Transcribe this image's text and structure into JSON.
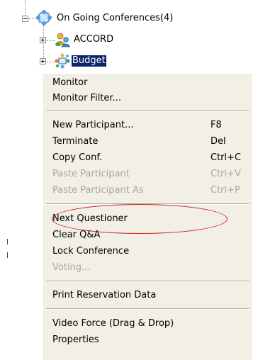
{
  "tree": {
    "root": {
      "label": "On Going Conferences(4)",
      "expander": "minus",
      "icon": "conferences-icon"
    },
    "children": [
      {
        "label": "ACCORD",
        "expander": "plus",
        "icon": "participants-icon",
        "selected": false
      },
      {
        "label": "Budget",
        "expander": "plus",
        "icon": "conference-icon",
        "selected": true
      }
    ]
  },
  "menu": {
    "groups": [
      [
        {
          "label": "Monitor",
          "shortcut": "",
          "enabled": true
        },
        {
          "label": "Monitor Filter...",
          "shortcut": "",
          "enabled": true
        }
      ],
      [
        {
          "label": "New Participant...",
          "shortcut": "F8",
          "enabled": true
        },
        {
          "label": "Terminate",
          "shortcut": "Del",
          "enabled": true
        },
        {
          "label": "Copy Conf.",
          "shortcut": "Ctrl+C",
          "enabled": true
        },
        {
          "label": "Paste Participant",
          "shortcut": "Ctrl+V",
          "enabled": false
        },
        {
          "label": "Paste Participant As",
          "shortcut": "Ctrl+P",
          "enabled": false
        }
      ],
      [
        {
          "label": "Next Questioner",
          "shortcut": "",
          "enabled": true,
          "highlighted_by_annotation": true
        },
        {
          "label": "Clear Q&A",
          "shortcut": "",
          "enabled": true
        },
        {
          "label": "Lock Conference",
          "shortcut": "",
          "enabled": true
        },
        {
          "label": "Voting...",
          "shortcut": "",
          "enabled": false
        }
      ],
      [
        {
          "label": "Print Reservation Data",
          "shortcut": "",
          "enabled": true
        }
      ],
      [
        {
          "label": "Video Force (Drag & Drop)",
          "shortcut": "",
          "enabled": true
        },
        {
          "label": "Properties",
          "shortcut": "",
          "enabled": true
        }
      ]
    ]
  },
  "colors": {
    "menu_bg": "#f1efe6",
    "selection_bg": "#0a246a",
    "disabled_text": "#a9a89f",
    "annotation": "#d02020"
  }
}
